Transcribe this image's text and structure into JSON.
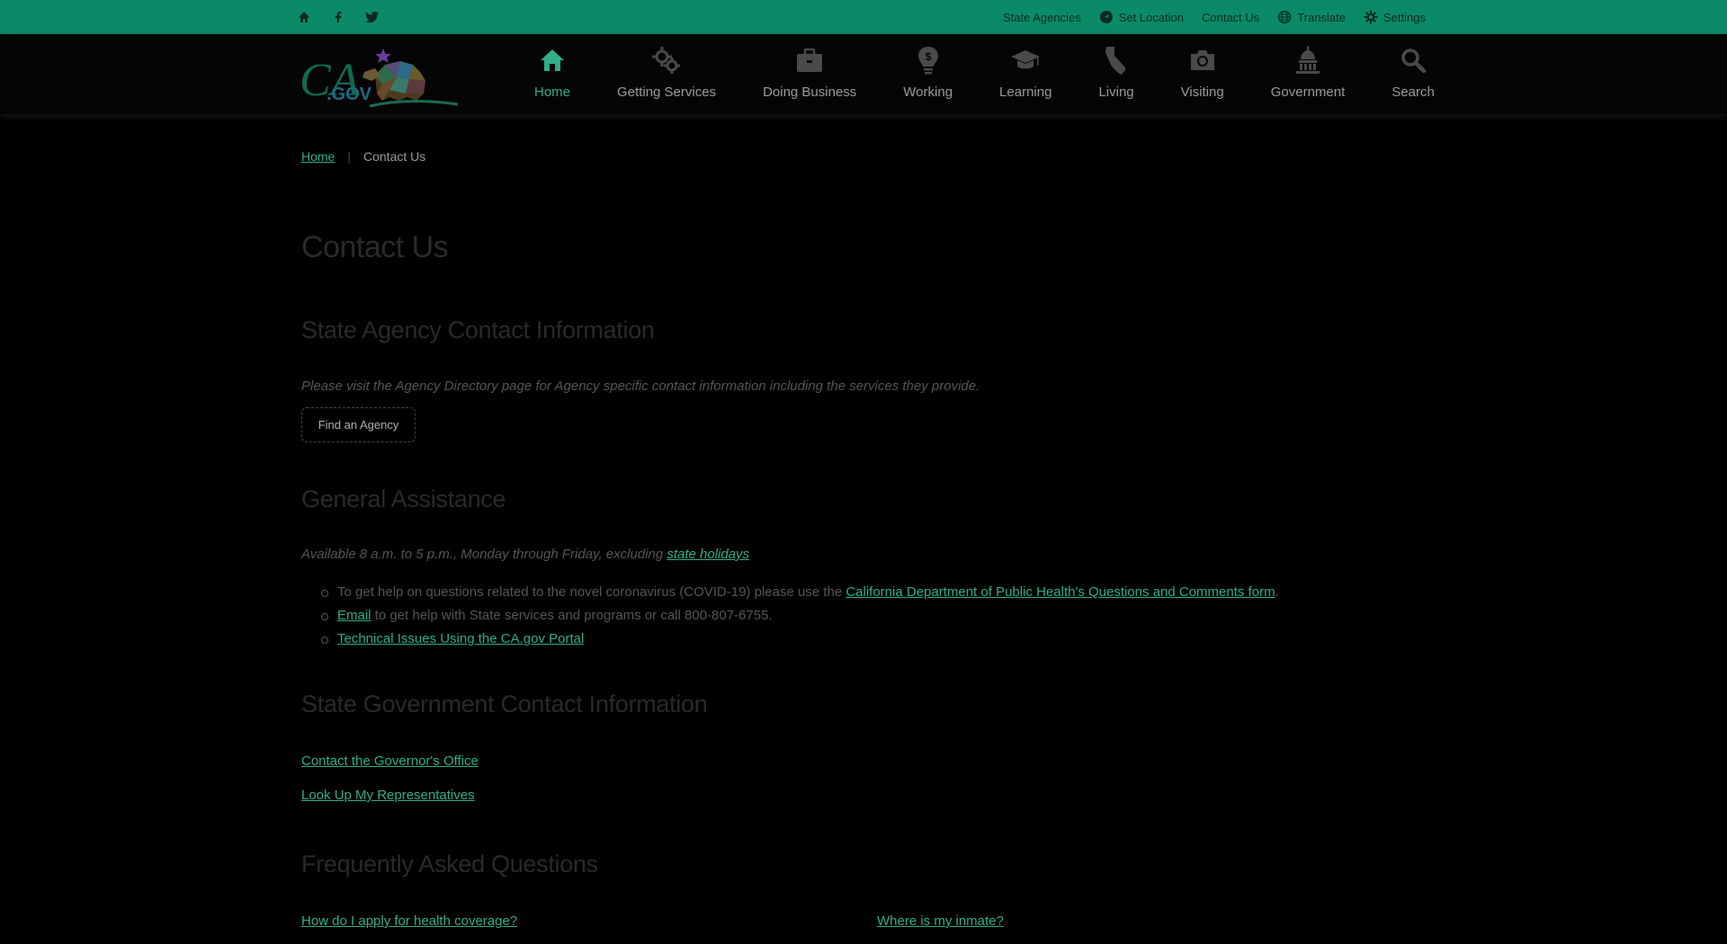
{
  "colors": {
    "utility_bar": "#0a8a67",
    "link": "#2fae87",
    "background": "#000000"
  },
  "utility": {
    "social": [
      {
        "icon": "home-icon"
      },
      {
        "icon": "facebook-icon"
      },
      {
        "icon": "twitter-icon"
      }
    ],
    "links": {
      "state_agencies": "State Agencies",
      "set_location": "Set Location",
      "contact_us": "Contact Us",
      "translate": "Translate",
      "settings": "Settings"
    }
  },
  "header": {
    "logo_text": "CA.GOV",
    "nav": [
      {
        "label": "Home",
        "icon": "home-icon"
      },
      {
        "label": "Getting Services",
        "icon": "gears-icon"
      },
      {
        "label": "Doing Business",
        "icon": "briefcase-icon"
      },
      {
        "label": "Working",
        "icon": "lightbulb-dollar-icon"
      },
      {
        "label": "Learning",
        "icon": "graduation-cap-icon"
      },
      {
        "label": "Living",
        "icon": "california-icon"
      },
      {
        "label": "Visiting",
        "icon": "camera-icon"
      },
      {
        "label": "Government",
        "icon": "capitol-icon"
      },
      {
        "label": "Search",
        "icon": "search-icon"
      }
    ]
  },
  "breadcrumb": {
    "home": "Home",
    "current": "Contact Us"
  },
  "page_title": "Contact Us",
  "agency": {
    "heading": "State Agency Contact Information",
    "text": "Please visit the Agency Directory page for Agency specific contact information including the services they provide.",
    "button": "Find an Agency"
  },
  "general": {
    "heading": "General Assistance",
    "hours_text": "Available 8 a.m. to 5 p.m., Monday through Friday, excluding ",
    "hours_link": "state holidays",
    "items": {
      "covid_text": "To get help on questions related to the novel coronavirus (COVID-19) please use the ",
      "covid_link": "California Department of Public Health's Questions and Comments form",
      "covid_end": ".",
      "email_link": "Email",
      "email_text": " to get help with State services and programs or call 800-807-6755.",
      "tech_link": "Technical Issues Using the CA.gov Portal"
    }
  },
  "government": {
    "heading": "State Government Contact Information",
    "governor_link": "Contact the Governor's Office",
    "reps_link": "Look Up My Representatives"
  },
  "faq": {
    "heading": "Frequently Asked Questions",
    "q1": "How do I apply for health coverage?",
    "q2": "Where is my inmate?"
  }
}
